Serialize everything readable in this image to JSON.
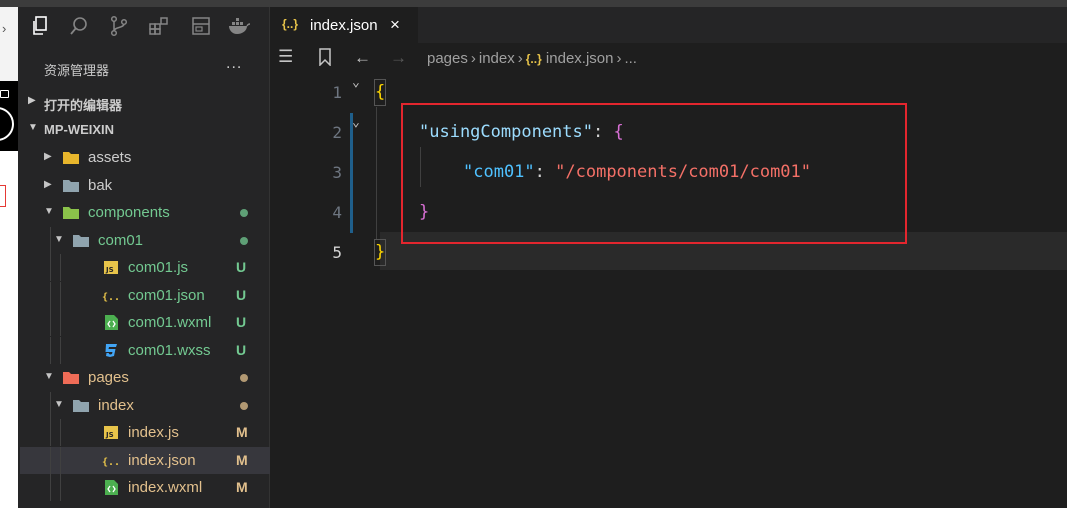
{
  "explorer": {
    "title": "资源管理器",
    "more": "...",
    "sections": {
      "open_editors": "打开的编辑器",
      "project": "MP-WEIXIN"
    },
    "tree": [
      {
        "name": "assets",
        "kind": "folder",
        "color": "#cccccc",
        "badge": ""
      },
      {
        "name": "bak",
        "kind": "folder",
        "color": "#cccccc",
        "badge": ""
      },
      {
        "name": "components",
        "kind": "folder",
        "color": "#73c991",
        "badge": "dot"
      },
      {
        "name": "com01",
        "kind": "folder",
        "color": "#73c991",
        "badge": "dot"
      },
      {
        "name": "com01.js",
        "kind": "js",
        "color": "#73c991",
        "badge": "U"
      },
      {
        "name": "com01.json",
        "kind": "json",
        "color": "#73c991",
        "badge": "U"
      },
      {
        "name": "com01.wxml",
        "kind": "wxml",
        "color": "#73c991",
        "badge": "U"
      },
      {
        "name": "com01.wxss",
        "kind": "wxss",
        "color": "#73c991",
        "badge": "U"
      },
      {
        "name": "pages",
        "kind": "folder",
        "color": "#e2c08d",
        "badge": "dot"
      },
      {
        "name": "index",
        "kind": "folder",
        "color": "#e2c08d",
        "badge": "dot"
      },
      {
        "name": "index.js",
        "kind": "js",
        "color": "#e2c08d",
        "badge": "M"
      },
      {
        "name": "index.json",
        "kind": "json",
        "color": "#e2c08d",
        "badge": "M"
      },
      {
        "name": "index.wxml",
        "kind": "wxml",
        "color": "#e2c08d",
        "badge": "M"
      }
    ],
    "badge_colors": {
      "U": "#73c991",
      "M": "#e2c08d"
    }
  },
  "tab": {
    "icon": "{..}",
    "label": "index.json",
    "close": "×"
  },
  "breadcrumb": {
    "parts": [
      "pages",
      "index",
      "index.json",
      "..."
    ],
    "json_icon": "{..}"
  },
  "editor": {
    "line_numbers": [
      "1",
      "2",
      "3",
      "4",
      "5"
    ],
    "active_line": "5",
    "code": {
      "l1_open": "{",
      "l2_key": "\"usingComponents\"",
      "l2_colon": ": ",
      "l2_brace": "{",
      "l3_key": "\"com01\"",
      "l3_colon": ": ",
      "l3_value": "\"/components/com01/com01\"",
      "l4_close": "}",
      "l5_close": "}"
    }
  },
  "colors": {
    "annotation_box": "#e3262e",
    "accent_yellow": "#ffd700",
    "accent_magenta": "#da70d6"
  }
}
